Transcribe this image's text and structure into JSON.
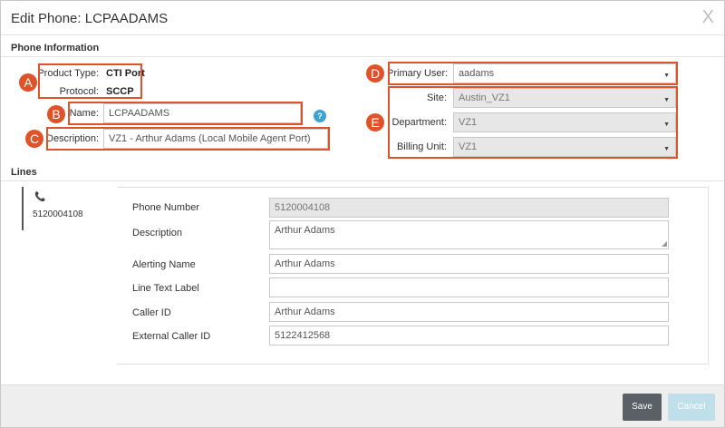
{
  "dialog": {
    "title": "Edit Phone: LCPAADAMS",
    "close_glyph": "X"
  },
  "phone_info": {
    "section_title": "Phone Information",
    "product_type_label": "Product Type:",
    "product_type_value": "CTI Port",
    "protocol_label": "Protocol:",
    "protocol_value": "SCCP",
    "name_label": "Name:",
    "name_value": "LCPAADAMS",
    "help_glyph": "?",
    "description_label": "Description:",
    "description_value": "VZ1 - Arthur Adams (Local Mobile Agent Port)",
    "primary_user_label": "Primary User:",
    "primary_user_value": "aadams",
    "site_label": "Site:",
    "site_value": "Austin_VZ1",
    "department_label": "Department:",
    "department_value": "VZ1",
    "billing_unit_label": "Billing Unit:",
    "billing_unit_value": "VZ1"
  },
  "callouts": {
    "a": "A",
    "b": "B",
    "c": "C",
    "d": "D",
    "e": "E"
  },
  "lines": {
    "section_title": "Lines",
    "tab_number": "5120004108",
    "phone_number_label": "Phone Number",
    "phone_number_value": "5120004108",
    "description_label": "Description",
    "description_value": "Arthur Adams",
    "alerting_name_label": "Alerting Name",
    "alerting_name_value": "Arthur Adams",
    "line_text_label_label": "Line Text Label",
    "line_text_label_value": "",
    "caller_id_label": "Caller ID",
    "caller_id_value": "Arthur Adams",
    "external_caller_id_label": "External Caller ID",
    "external_caller_id_value": "5122412568"
  },
  "footer": {
    "save_label": "Save",
    "cancel_label": "Cancel"
  },
  "colors": {
    "callout": "#e0532a",
    "save_button": "#5a6066",
    "cancel_button": "#bfe0ea",
    "help_icon": "#3ba3d4"
  },
  "icons": {
    "phone": "phone-icon",
    "dropdown": "caret-down-icon",
    "help": "help-icon",
    "close": "close-icon"
  }
}
